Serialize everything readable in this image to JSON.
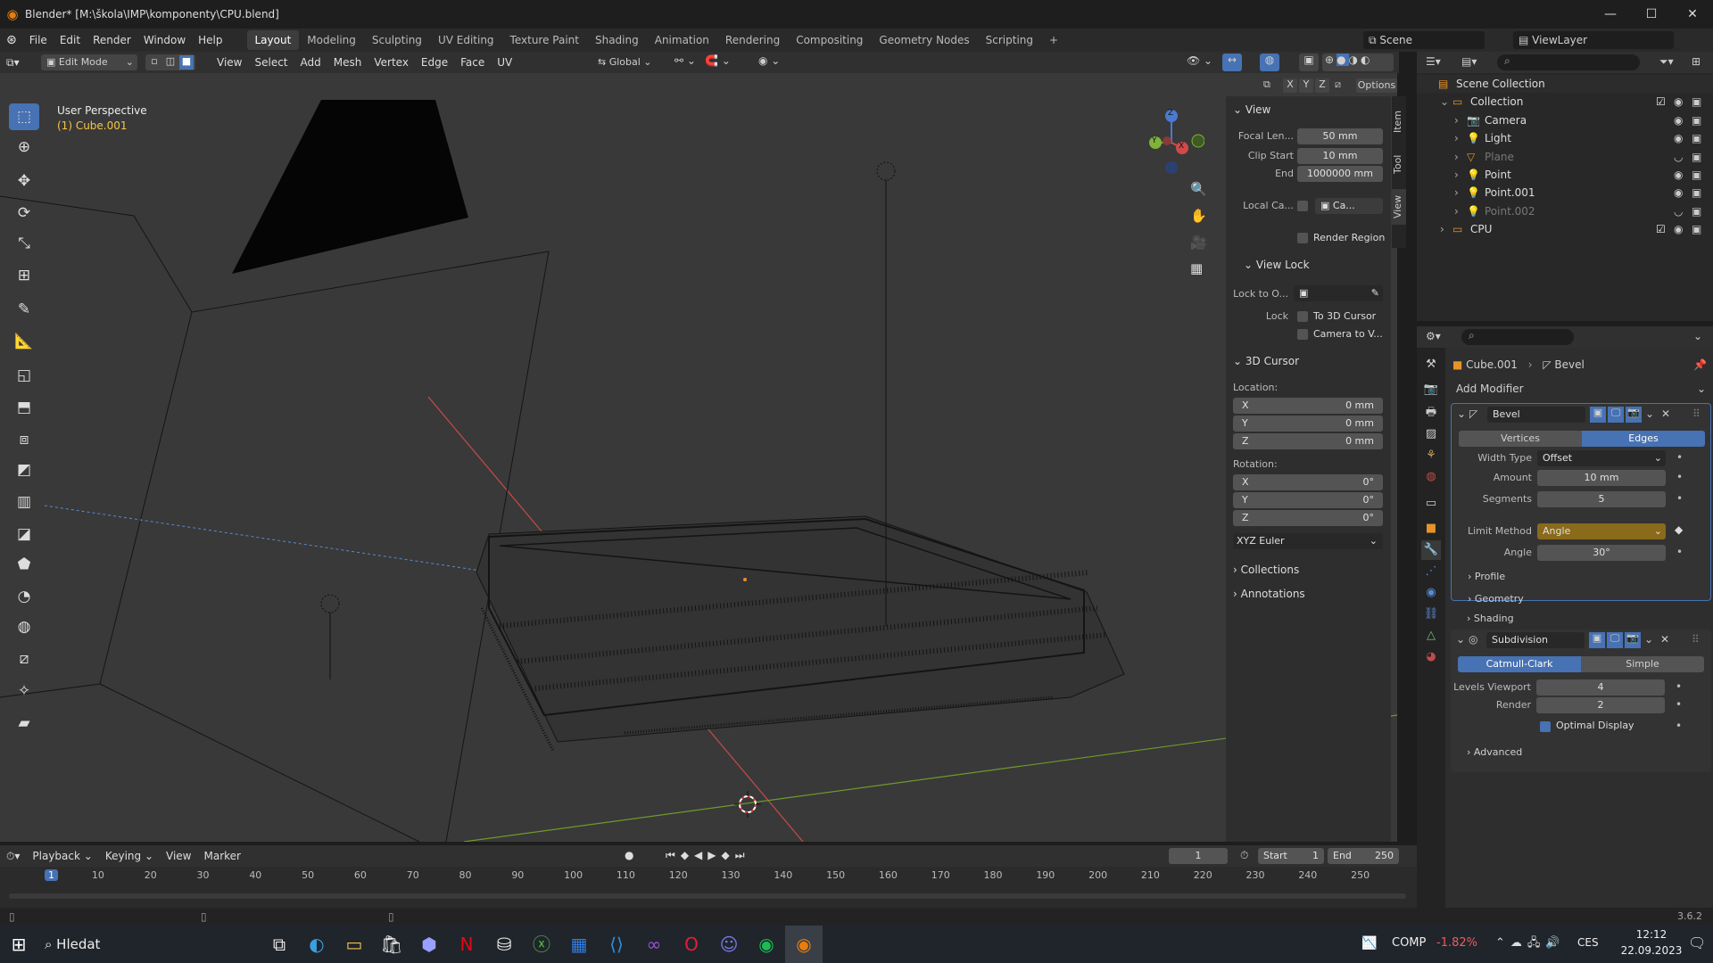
{
  "window": {
    "title": "Blender* [M:\\škola\\IMP\\komponenty\\CPU.blend]",
    "minimize": "—",
    "maximize": "☐",
    "close": "✕"
  },
  "menu": [
    "File",
    "Edit",
    "Render",
    "Window",
    "Help"
  ],
  "workspaces": [
    "Layout",
    "Modeling",
    "Sculpting",
    "UV Editing",
    "Texture Paint",
    "Shading",
    "Animation",
    "Rendering",
    "Compositing",
    "Geometry Nodes",
    "Scripting"
  ],
  "add_workspace": "+",
  "scene": {
    "label": "Scene",
    "view_layer": "ViewLayer"
  },
  "header3d": {
    "mode": "Edit Mode",
    "menus": [
      "View",
      "Select",
      "Add",
      "Mesh",
      "Vertex",
      "Edge",
      "Face",
      "UV"
    ],
    "orientation": "Global",
    "axes": [
      "X",
      "Y",
      "Z"
    ],
    "options": "Options"
  },
  "viewport": {
    "perspective": "User Perspective",
    "object": "(1) Cube.001"
  },
  "gizmo": {
    "z": "Z",
    "y": "Y",
    "x": "X"
  },
  "npanel": {
    "tabs": [
      "Item",
      "Tool",
      "View"
    ],
    "view_title": "View",
    "focal_label": "Focal Len...",
    "focal_value": "50 mm",
    "clip_start_label": "Clip Start",
    "clip_start_value": "10 mm",
    "clip_end_label": "End",
    "clip_end_value": "1000000 mm",
    "local_cam_label": "Local Ca...",
    "local_cam_value": "Ca...",
    "render_region": "Render Region",
    "view_lock_title": "View Lock",
    "lock_to_label": "Lock to O...",
    "lock_label": "Lock",
    "to_3d_cursor": "To 3D Cursor",
    "camera_to_view": "Camera to V...",
    "cursor_title": "3D Cursor",
    "location_label": "Location:",
    "loc": [
      {
        "a": "X",
        "v": "0 mm"
      },
      {
        "a": "Y",
        "v": "0 mm"
      },
      {
        "a": "Z",
        "v": "0 mm"
      }
    ],
    "rotation_label": "Rotation:",
    "rot": [
      {
        "a": "X",
        "v": "0°"
      },
      {
        "a": "Y",
        "v": "0°"
      },
      {
        "a": "Z",
        "v": "0°"
      }
    ],
    "rot_mode": "XYZ Euler",
    "collections": "Collections",
    "annotations": "Annotations"
  },
  "outliner": {
    "rows": [
      {
        "name": "Scene Collection",
        "indent": 0
      },
      {
        "name": "Collection",
        "indent": 1
      },
      {
        "name": "Camera",
        "indent": 2
      },
      {
        "name": "Light",
        "indent": 2
      },
      {
        "name": "Plane",
        "indent": 2
      },
      {
        "name": "Point",
        "indent": 2
      },
      {
        "name": "Point.001",
        "indent": 2
      },
      {
        "name": "Point.002",
        "indent": 2
      },
      {
        "name": "CPU",
        "indent": 1
      }
    ]
  },
  "properties": {
    "breadcrumb_object": "Cube.001",
    "breadcrumb_modifier": "Bevel",
    "add_modifier": "Add Modifier",
    "bevel": {
      "name": "Bevel",
      "tab_vertices": "Vertices",
      "tab_edges": "Edges",
      "width_type_label": "Width Type",
      "width_type_value": "Offset",
      "amount_label": "Amount",
      "amount_value": "10 mm",
      "segments_label": "Segments",
      "segments_value": "5",
      "limit_label": "Limit Method",
      "limit_value": "Angle",
      "angle_label": "Angle",
      "angle_value": "30°",
      "profile": "Profile",
      "geometry": "Geometry",
      "shading": "Shading"
    },
    "subdiv": {
      "name": "Subdivision",
      "catmull": "Catmull-Clark",
      "simple": "Simple",
      "levels_label": "Levels Viewport",
      "levels_value": "4",
      "render_label": "Render",
      "render_value": "2",
      "optimal": "Optimal Display",
      "advanced": "Advanced"
    }
  },
  "timeline": {
    "menus": [
      "Playback",
      "Keying",
      "View",
      "Marker"
    ],
    "current_frame": "1",
    "start_label": "Start",
    "start_value": "1",
    "end_label": "End",
    "end_value": "250",
    "ruler": [
      "1",
      "10",
      "20",
      "30",
      "40",
      "50",
      "60",
      "70",
      "80",
      "90",
      "100",
      "110",
      "120",
      "130",
      "140",
      "150",
      "160",
      "170",
      "180",
      "190",
      "200",
      "210",
      "220",
      "230",
      "240",
      "250"
    ]
  },
  "status": {
    "version": "3.6.2"
  },
  "taskbar": {
    "search": "Hledat",
    "stock": "COMP",
    "stock_change": "-1.82%",
    "lang": "CES",
    "time": "12:12",
    "date": "22.09.2023"
  },
  "colors": {
    "accent": "#4772b3",
    "selected_text": "#f5c542",
    "limit_method_bg": "#8a6a1b",
    "red_axis": "#c84a4a",
    "green_axis": "#6f9a2a"
  }
}
